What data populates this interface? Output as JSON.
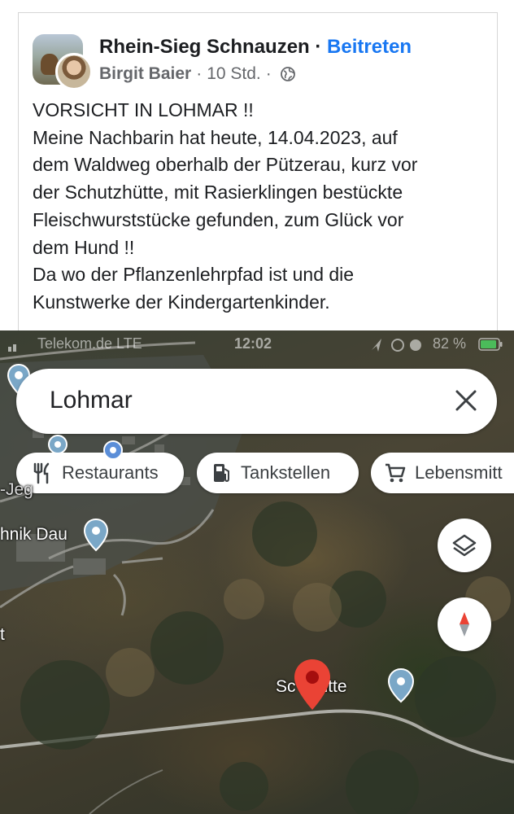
{
  "post": {
    "group_name": "Rhein-Sieg Schnauzen",
    "separator": "·",
    "join_label": "Beitreten",
    "author": "Birgit Baier",
    "time": "10 Std.",
    "meta_separator": "·",
    "privacy_icon": "globe-icon",
    "lines": [
      "VORSICHT IN LOHMAR !!",
      "Meine Nachbarin hat heute, 14.04.2023, auf",
      "dem Waldweg oberhalb der Pützerau, kurz vor",
      "der Schutzhütte, mit Rasierklingen bestückte",
      "Fleischwurststücke gefunden, zum Glück vor",
      "dem Hund !!",
      "Da wo der Pflanzenlehrpfad ist und die",
      "Kunstwerke der Kindergartenkinder."
    ]
  },
  "status_bar": {
    "carrier": "Telekom.de LTE",
    "time": "12:02",
    "battery": "82 %"
  },
  "map": {
    "search_value": "Lohmar",
    "clear_icon": "close-icon",
    "chips": [
      {
        "label": "Restaurants",
        "icon": "restaurant-icon"
      },
      {
        "label": "Tankstellen",
        "icon": "gas-station-icon"
      },
      {
        "label": "Lebensmitt",
        "icon": "shopping-cart-icon"
      }
    ],
    "layers_icon": "layers-icon",
    "compass_icon": "compass-icon",
    "labels": {
      "street": "-Jeg",
      "technik": "hnik Dau",
      "edge": "t",
      "hutte": "Sc    zhütte"
    },
    "colors": {
      "pin_red": "#ea4335",
      "poi_blue": "#7aa7c7",
      "link_blue": "#1877f2"
    }
  }
}
